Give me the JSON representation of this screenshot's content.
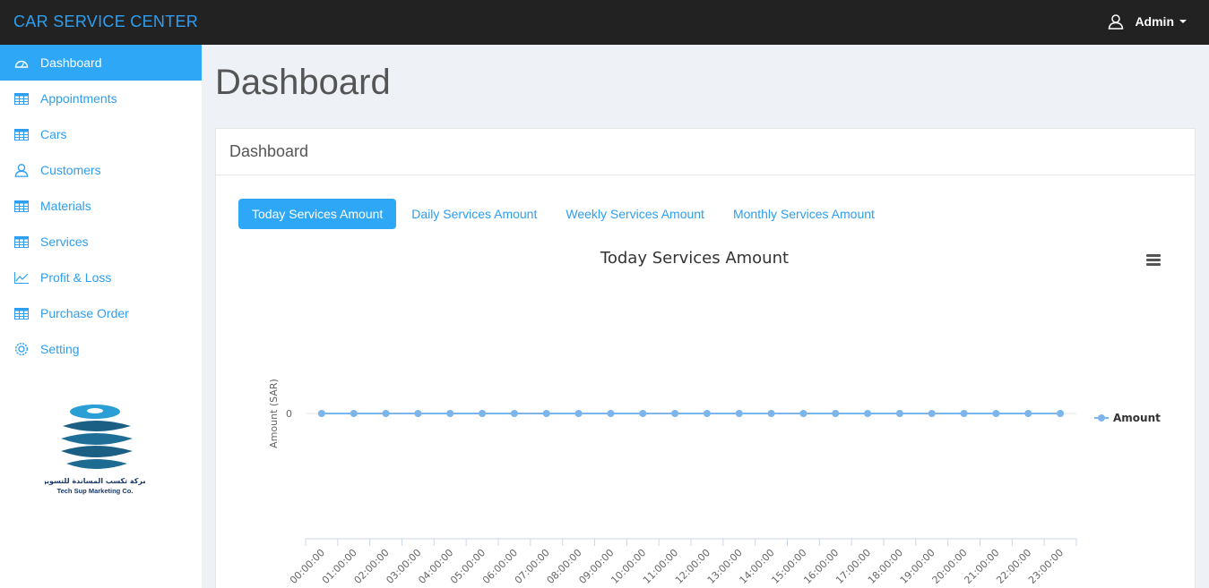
{
  "header": {
    "brand": "CAR SERVICE CENTER",
    "user": "Admin"
  },
  "sidebar": {
    "items": [
      {
        "label": "Dashboard",
        "icon": "dashboard-icon",
        "active": true
      },
      {
        "label": "Appointments",
        "icon": "table-icon"
      },
      {
        "label": "Cars",
        "icon": "table-icon"
      },
      {
        "label": "Customers",
        "icon": "user-icon"
      },
      {
        "label": "Materials",
        "icon": "table-icon"
      },
      {
        "label": "Services",
        "icon": "table-icon"
      },
      {
        "label": "Profit & Loss",
        "icon": "line-chart-icon"
      },
      {
        "label": "Purchase Order",
        "icon": "table-icon"
      },
      {
        "label": "Setting",
        "icon": "gear-icon"
      }
    ],
    "logo": {
      "arabic": "شركة تكسب المساندة للتسويق",
      "english": "Tech Sup Marketing Co."
    }
  },
  "main": {
    "title": "Dashboard",
    "panel_title": "Dashboard",
    "tabs": [
      "Today Services Amount",
      "Daily Services Amount",
      "Weekly Services Amount",
      "Monthly Services Amount"
    ],
    "active_tab": 0
  },
  "colors": {
    "accent": "#2ea7f6",
    "topbar": "#222222",
    "series": "#7cb5ec"
  },
  "chart_data": {
    "type": "line",
    "title": "Today Services Amount",
    "ylabel": "Amount (SAR)",
    "xlabel": "",
    "categories": [
      "00:00:00",
      "01:00:00",
      "02:00:00",
      "03:00:00",
      "04:00:00",
      "05:00:00",
      "06:00:00",
      "07:00:00",
      "08:00:00",
      "09:00:00",
      "10:00:00",
      "11:00:00",
      "12:00:00",
      "13:00:00",
      "14:00:00",
      "15:00:00",
      "16:00:00",
      "17:00:00",
      "18:00:00",
      "19:00:00",
      "20:00:00",
      "21:00:00",
      "22:00:00",
      "23:00:00"
    ],
    "series": [
      {
        "name": "Amount",
        "values": [
          0,
          0,
          0,
          0,
          0,
          0,
          0,
          0,
          0,
          0,
          0,
          0,
          0,
          0,
          0,
          0,
          0,
          0,
          0,
          0,
          0,
          0,
          0,
          0
        ]
      }
    ],
    "y_ticks": [
      "0"
    ],
    "legend": "right"
  }
}
